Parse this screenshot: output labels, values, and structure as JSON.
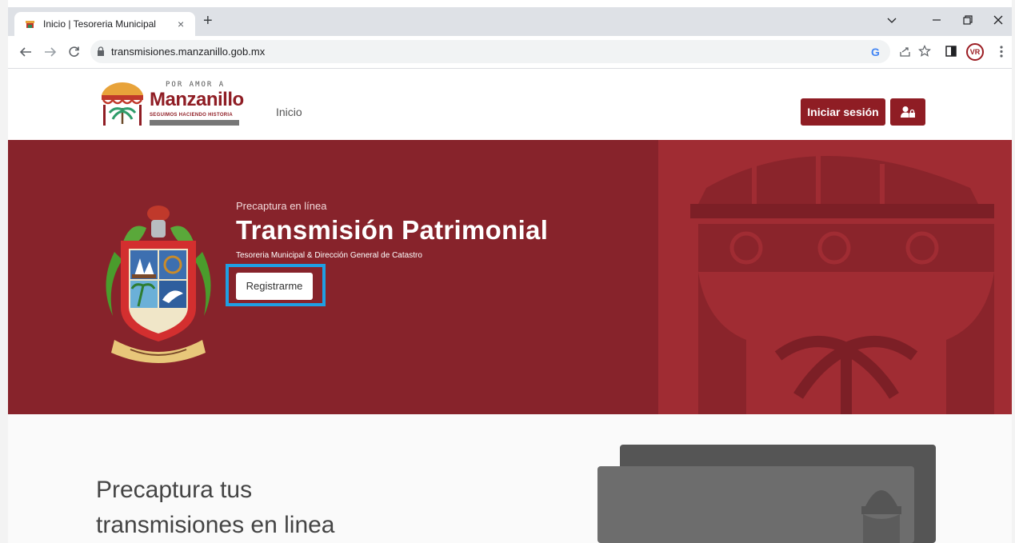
{
  "browser": {
    "tab_title": "Inicio | Tesoreria Municipal",
    "tab_close": "×",
    "new_tab": "+",
    "url": "transmisiones.manzanillo.gob.mx",
    "profile_initials": "VR",
    "google_letter": "G"
  },
  "header": {
    "logo": {
      "top_text": "POR AMOR A",
      "brand": "Manzanillo",
      "tagline": "SEGUIMOS HACIENDO HISTORIA"
    },
    "nav_inicio": "Inicio",
    "login_label": "Iniciar sesión"
  },
  "hero": {
    "subtitle": "Precaptura en línea",
    "title": "Transmisión Patrimonial",
    "org": "Tesoreria Municipal & Dirección General de Catastro",
    "register_label": "Registrarme"
  },
  "lower": {
    "title_line1": "Precaptura tus",
    "title_line2": "transmisiones en linea"
  },
  "colors": {
    "brand": "#8f1d24",
    "hero_bg": "#87232b",
    "highlight": "#1f9fe3"
  }
}
